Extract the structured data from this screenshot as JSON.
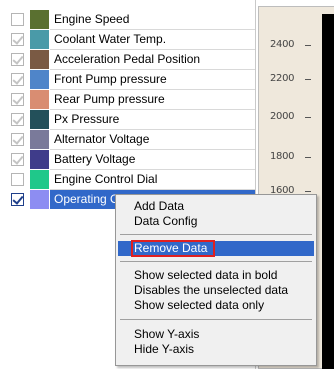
{
  "series": [
    {
      "label": "Engine Speed",
      "color": "#5a7030",
      "checked": false
    },
    {
      "label": "Coolant Water Temp.",
      "color": "#4a9aa8",
      "checked": true
    },
    {
      "label": "Acceleration Pedal Position",
      "color": "#7a5a44",
      "checked": true
    },
    {
      "label": "Front Pump pressure",
      "color": "#4f85c9",
      "checked": true
    },
    {
      "label": "Rear Pump pressure",
      "color": "#d98d72",
      "checked": true
    },
    {
      "label": "Px Pressure",
      "color": "#23505a",
      "checked": true
    },
    {
      "label": "Alternator Voltage",
      "color": "#7a7a9a",
      "checked": true
    },
    {
      "label": "Battery Voltage",
      "color": "#3f3c8a",
      "checked": true
    },
    {
      "label": "Engine Control Dial",
      "color": "#1fc88a",
      "checked": false
    },
    {
      "label": "Operating Oil Temp.",
      "color": "#8d8df2",
      "checked": true,
      "selected": true
    }
  ],
  "chart": {
    "y_ticks": [
      "2400",
      "2200",
      "2000",
      "1800",
      "1600"
    ]
  },
  "context_menu": {
    "groups": [
      [
        "Add Data",
        "Data Config"
      ],
      [
        "Remove Data"
      ],
      [
        "Show selected data in bold",
        "Disables the unselected data",
        "Show selected data only"
      ],
      [
        "Show Y-axis",
        "Hide Y-axis"
      ]
    ],
    "highlighted": "Remove Data"
  }
}
